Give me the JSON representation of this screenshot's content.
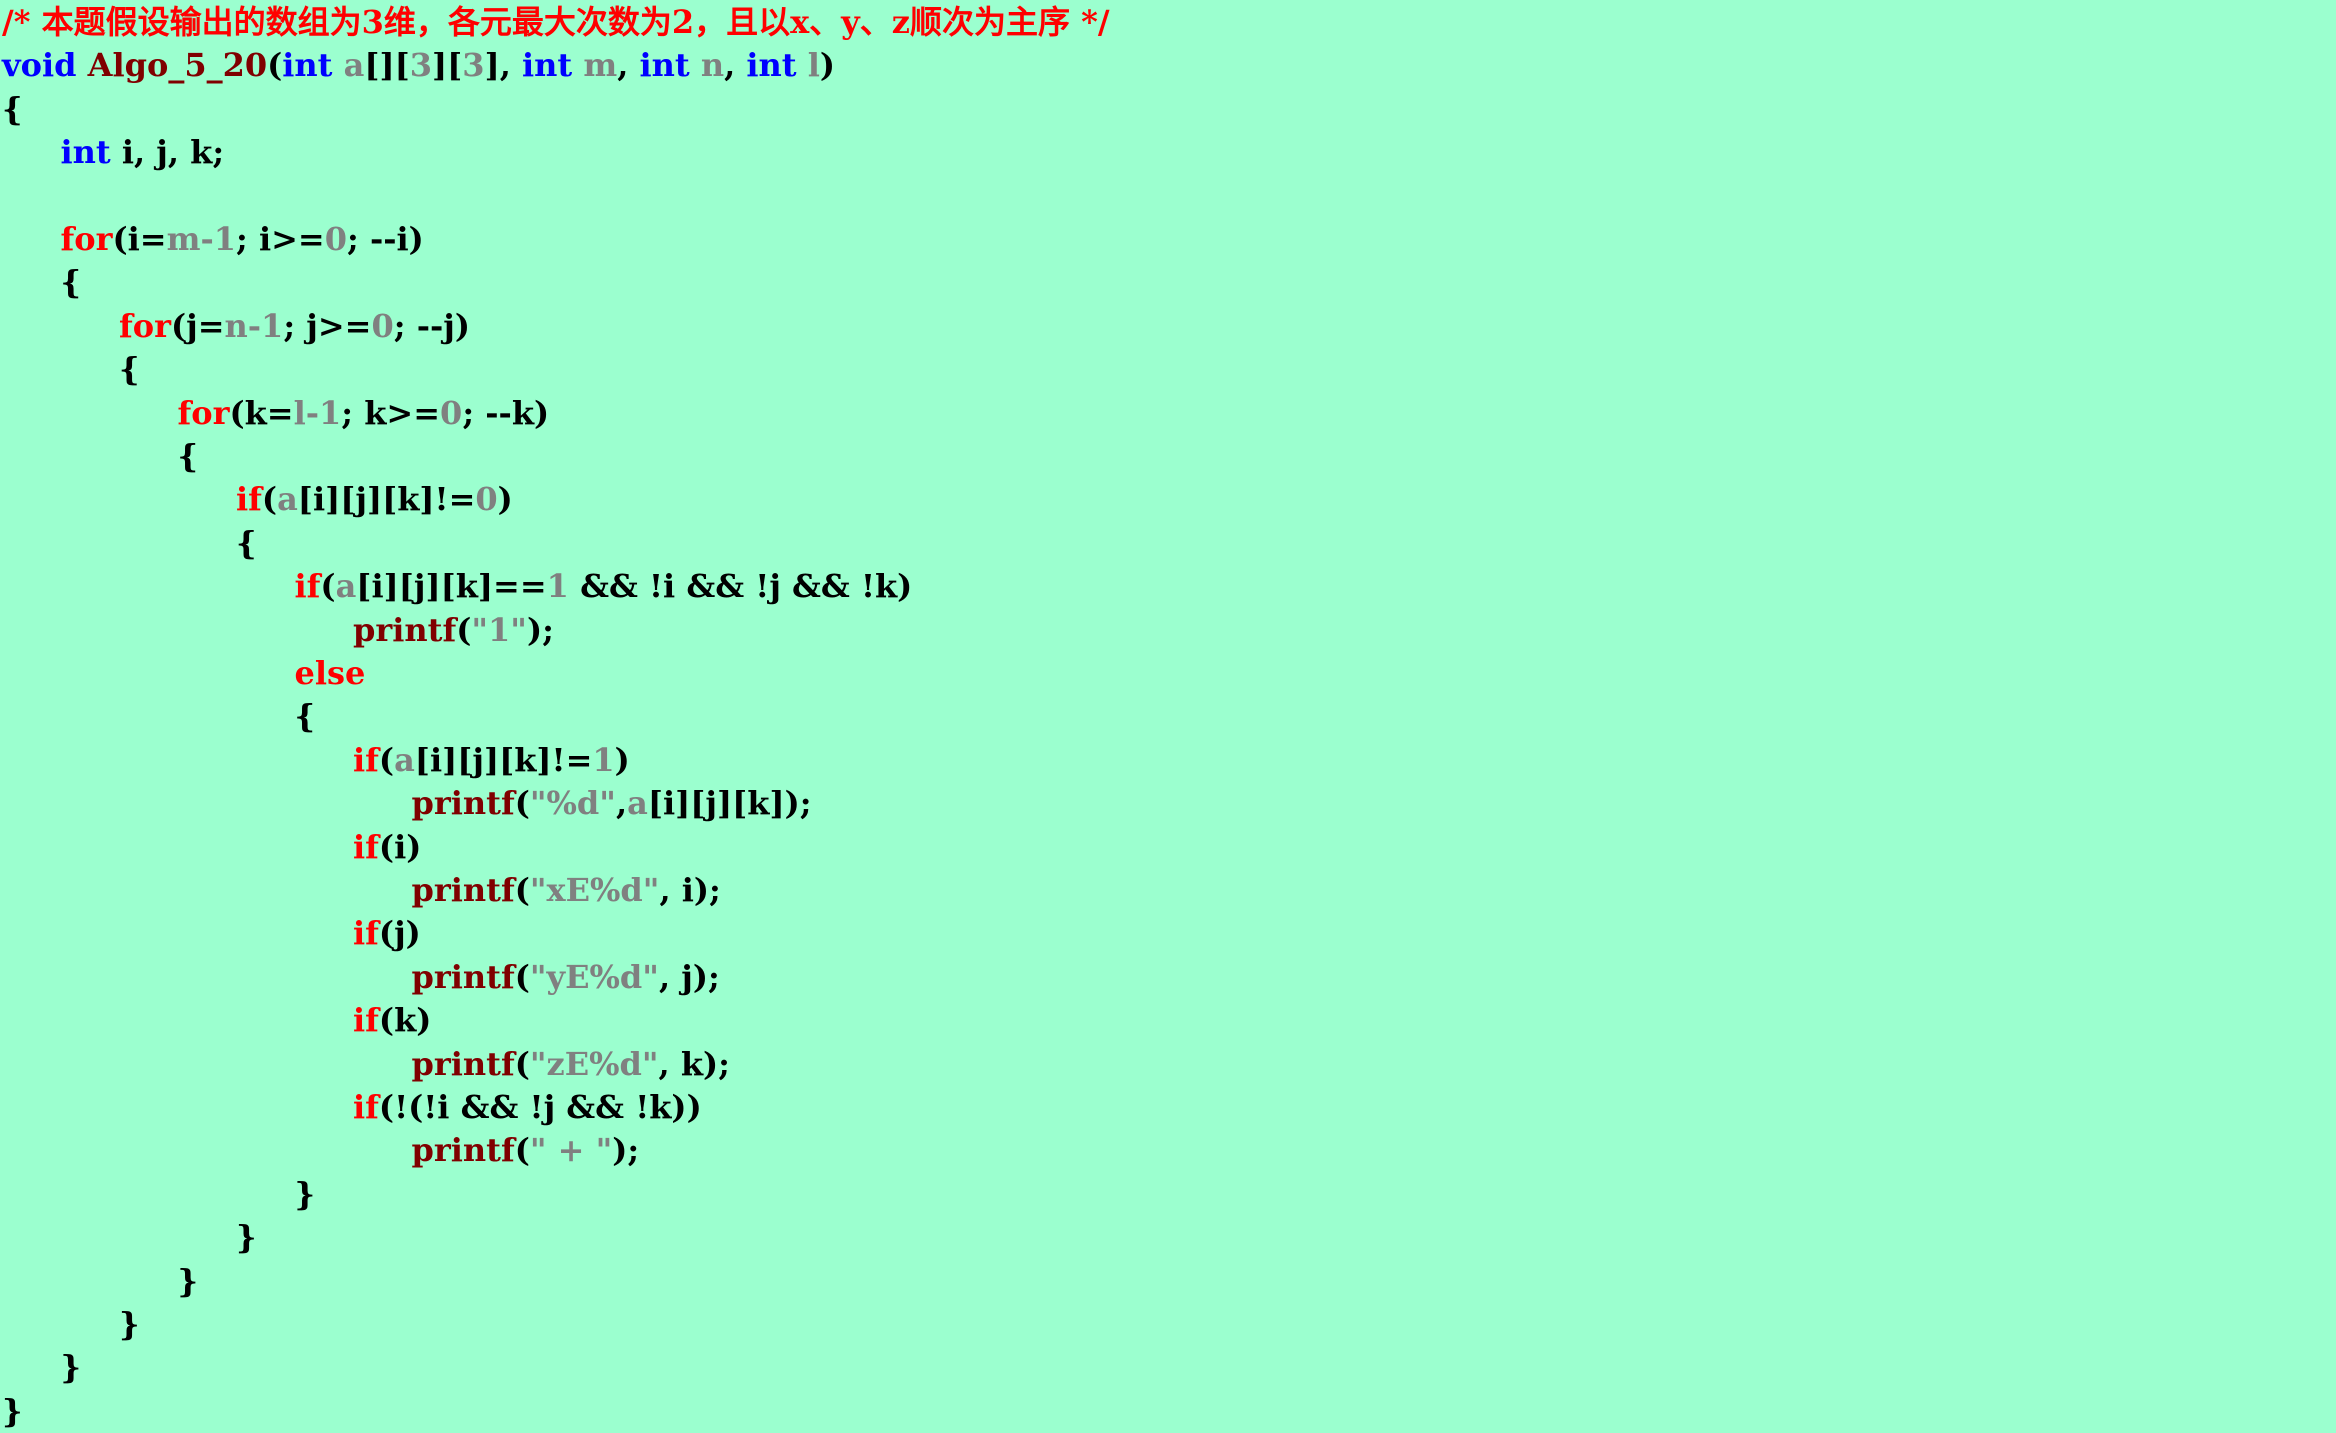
{
  "colors": {
    "background": "#9bffcf",
    "comment": "#ff0000",
    "type": "#0000ff",
    "function": "#800000",
    "keyword": "#ff0000",
    "number": "#808080",
    "string": "#808080",
    "parameter": "#808080",
    "call": "#800000",
    "plain": "#000000"
  },
  "lines": [
    {
      "indent": 0,
      "tokens": [
        {
          "t": "comment",
          "v": "/* 本题假设输出的数组为3维，各元最大次数为2，且以x、y、z顺次为主序 */"
        }
      ]
    },
    {
      "indent": 0,
      "tokens": [
        {
          "t": "type",
          "v": "void"
        },
        {
          "t": "plain",
          "v": " "
        },
        {
          "t": "fn",
          "v": "Algo_5_20"
        },
        {
          "t": "plain",
          "v": "("
        },
        {
          "t": "type",
          "v": "int"
        },
        {
          "t": "plain",
          "v": " "
        },
        {
          "t": "param",
          "v": "a"
        },
        {
          "t": "plain",
          "v": "[]["
        },
        {
          "t": "num",
          "v": "3"
        },
        {
          "t": "plain",
          "v": "]["
        },
        {
          "t": "num",
          "v": "3"
        },
        {
          "t": "plain",
          "v": "], "
        },
        {
          "t": "type",
          "v": "int"
        },
        {
          "t": "plain",
          "v": " "
        },
        {
          "t": "param",
          "v": "m"
        },
        {
          "t": "plain",
          "v": ", "
        },
        {
          "t": "type",
          "v": "int"
        },
        {
          "t": "plain",
          "v": " "
        },
        {
          "t": "param",
          "v": "n"
        },
        {
          "t": "plain",
          "v": ", "
        },
        {
          "t": "type",
          "v": "int"
        },
        {
          "t": "plain",
          "v": " "
        },
        {
          "t": "param",
          "v": "l"
        },
        {
          "t": "plain",
          "v": ")"
        }
      ]
    },
    {
      "indent": 0,
      "tokens": [
        {
          "t": "plain",
          "v": "{"
        }
      ]
    },
    {
      "indent": 1,
      "tokens": [
        {
          "t": "type",
          "v": "int"
        },
        {
          "t": "plain",
          "v": " i, j, k;"
        }
      ]
    },
    {
      "indent": 0,
      "tokens": []
    },
    {
      "indent": 1,
      "tokens": [
        {
          "t": "kw",
          "v": "for"
        },
        {
          "t": "plain",
          "v": "(i="
        },
        {
          "t": "param",
          "v": "m"
        },
        {
          "t": "num",
          "v": "-1"
        },
        {
          "t": "plain",
          "v": "; i>="
        },
        {
          "t": "num",
          "v": "0"
        },
        {
          "t": "plain",
          "v": "; --i)"
        }
      ]
    },
    {
      "indent": 1,
      "tokens": [
        {
          "t": "plain",
          "v": "{"
        }
      ]
    },
    {
      "indent": 2,
      "tokens": [
        {
          "t": "kw",
          "v": "for"
        },
        {
          "t": "plain",
          "v": "(j="
        },
        {
          "t": "param",
          "v": "n"
        },
        {
          "t": "num",
          "v": "-1"
        },
        {
          "t": "plain",
          "v": "; j>="
        },
        {
          "t": "num",
          "v": "0"
        },
        {
          "t": "plain",
          "v": "; --j)"
        }
      ]
    },
    {
      "indent": 2,
      "tokens": [
        {
          "t": "plain",
          "v": "{"
        }
      ]
    },
    {
      "indent": 3,
      "tokens": [
        {
          "t": "kw",
          "v": "for"
        },
        {
          "t": "plain",
          "v": "(k="
        },
        {
          "t": "param",
          "v": "l"
        },
        {
          "t": "num",
          "v": "-1"
        },
        {
          "t": "plain",
          "v": "; k>="
        },
        {
          "t": "num",
          "v": "0"
        },
        {
          "t": "plain",
          "v": "; --k)"
        }
      ]
    },
    {
      "indent": 3,
      "tokens": [
        {
          "t": "plain",
          "v": "{"
        }
      ]
    },
    {
      "indent": 4,
      "tokens": [
        {
          "t": "kw",
          "v": "if"
        },
        {
          "t": "plain",
          "v": "("
        },
        {
          "t": "param",
          "v": "a"
        },
        {
          "t": "plain",
          "v": "[i][j][k]!="
        },
        {
          "t": "num",
          "v": "0"
        },
        {
          "t": "plain",
          "v": ")"
        }
      ]
    },
    {
      "indent": 4,
      "tokens": [
        {
          "t": "plain",
          "v": "{"
        }
      ]
    },
    {
      "indent": 5,
      "tokens": [
        {
          "t": "kw",
          "v": "if"
        },
        {
          "t": "plain",
          "v": "("
        },
        {
          "t": "param",
          "v": "a"
        },
        {
          "t": "plain",
          "v": "[i][j][k]=="
        },
        {
          "t": "num",
          "v": "1"
        },
        {
          "t": "plain",
          "v": " && !i && !j && !k)"
        }
      ]
    },
    {
      "indent": 6,
      "tokens": [
        {
          "t": "call",
          "v": "printf"
        },
        {
          "t": "plain",
          "v": "("
        },
        {
          "t": "str",
          "v": "\"1\""
        },
        {
          "t": "plain",
          "v": ");"
        }
      ]
    },
    {
      "indent": 5,
      "tokens": [
        {
          "t": "kw",
          "v": "else"
        }
      ]
    },
    {
      "indent": 5,
      "tokens": [
        {
          "t": "plain",
          "v": "{"
        }
      ]
    },
    {
      "indent": 6,
      "tokens": [
        {
          "t": "kw",
          "v": "if"
        },
        {
          "t": "plain",
          "v": "("
        },
        {
          "t": "param",
          "v": "a"
        },
        {
          "t": "plain",
          "v": "[i][j][k]!="
        },
        {
          "t": "num",
          "v": "1"
        },
        {
          "t": "plain",
          "v": ")"
        }
      ]
    },
    {
      "indent": 7,
      "tokens": [
        {
          "t": "call",
          "v": "printf"
        },
        {
          "t": "plain",
          "v": "("
        },
        {
          "t": "str",
          "v": "\"%d\""
        },
        {
          "t": "plain",
          "v": ","
        },
        {
          "t": "param",
          "v": "a"
        },
        {
          "t": "plain",
          "v": "[i][j][k]);"
        }
      ]
    },
    {
      "indent": 6,
      "tokens": [
        {
          "t": "kw",
          "v": "if"
        },
        {
          "t": "plain",
          "v": "(i)"
        }
      ]
    },
    {
      "indent": 7,
      "tokens": [
        {
          "t": "call",
          "v": "printf"
        },
        {
          "t": "plain",
          "v": "("
        },
        {
          "t": "str",
          "v": "\"xE%d\""
        },
        {
          "t": "plain",
          "v": ", i);"
        }
      ]
    },
    {
      "indent": 6,
      "tokens": [
        {
          "t": "kw",
          "v": "if"
        },
        {
          "t": "plain",
          "v": "(j)"
        }
      ]
    },
    {
      "indent": 7,
      "tokens": [
        {
          "t": "call",
          "v": "printf"
        },
        {
          "t": "plain",
          "v": "("
        },
        {
          "t": "str",
          "v": "\"yE%d\""
        },
        {
          "t": "plain",
          "v": ", j);"
        }
      ]
    },
    {
      "indent": 6,
      "tokens": [
        {
          "t": "kw",
          "v": "if"
        },
        {
          "t": "plain",
          "v": "(k)"
        }
      ]
    },
    {
      "indent": 7,
      "tokens": [
        {
          "t": "call",
          "v": "printf"
        },
        {
          "t": "plain",
          "v": "("
        },
        {
          "t": "str",
          "v": "\"zE%d\""
        },
        {
          "t": "plain",
          "v": ", k);"
        }
      ]
    },
    {
      "indent": 6,
      "tokens": [
        {
          "t": "kw",
          "v": "if"
        },
        {
          "t": "plain",
          "v": "(!(!i && !j && !k))"
        }
      ]
    },
    {
      "indent": 7,
      "tokens": [
        {
          "t": "call",
          "v": "printf"
        },
        {
          "t": "plain",
          "v": "("
        },
        {
          "t": "str",
          "v": "\" + \""
        },
        {
          "t": "plain",
          "v": ");"
        }
      ]
    },
    {
      "indent": 5,
      "tokens": [
        {
          "t": "plain",
          "v": "}"
        }
      ]
    },
    {
      "indent": 4,
      "tokens": [
        {
          "t": "plain",
          "v": "}"
        }
      ]
    },
    {
      "indent": 3,
      "tokens": [
        {
          "t": "plain",
          "v": "}"
        }
      ]
    },
    {
      "indent": 2,
      "tokens": [
        {
          "t": "plain",
          "v": "}"
        }
      ]
    },
    {
      "indent": 1,
      "tokens": [
        {
          "t": "plain",
          "v": "}"
        }
      ]
    },
    {
      "indent": 0,
      "tokens": [
        {
          "t": "plain",
          "v": "}"
        }
      ]
    }
  ]
}
